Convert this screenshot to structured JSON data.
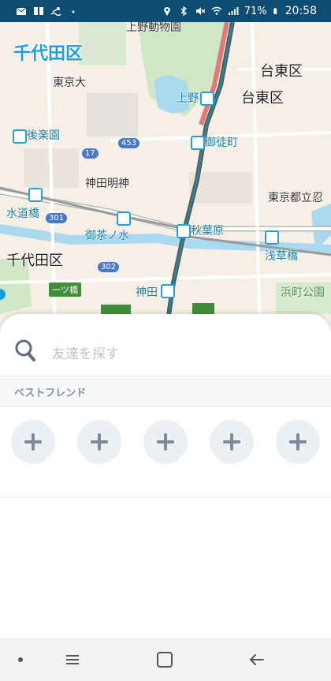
{
  "status_bar": {
    "battery": "71%",
    "time": "20:58",
    "icons": [
      "mail-icon",
      "book-icon",
      "swim-icon",
      "dot-icon",
      "location-icon",
      "bluetooth-icon",
      "mute-icon",
      "wifi-icon",
      "signal-icon",
      "battery-icon"
    ]
  },
  "map": {
    "ward_title": "千代田区",
    "labels": {
      "ueno_zoo": "上野動物園",
      "taito_ku_1": "台東区",
      "taito_ku_2": "台東区",
      "todai": "東京大",
      "ueno": "上野",
      "korakuen": "後楽園",
      "okachimachi": "御徒町",
      "kanda_myojin": "神田明神",
      "tokyo_toritsu": "東京都立忍",
      "suidobashi": "水道橋",
      "akihabara": "秋葉原",
      "ochanomizu": "御茶ノ水",
      "asakusabashi": "浅草橋",
      "chiyoda_ku": "千代田区",
      "hitotsubashi": "一ツ橋",
      "kanda": "神田",
      "hamacho_park": "浜町公園"
    },
    "route_badges": {
      "r17": "17",
      "r453": "453",
      "r301": "301",
      "r302": "302"
    }
  },
  "sheet": {
    "search_placeholder": "友達を探す",
    "section_title": "ベストフレンド",
    "best_friend_slots": [
      "add-friend-1",
      "add-friend-2",
      "add-friend-3",
      "add-friend-4",
      "add-friend-5"
    ]
  },
  "nav_bar": {
    "buttons": [
      "dot-icon",
      "recent-apps-icon",
      "home-icon",
      "back-icon"
    ]
  },
  "colors": {
    "status_bar": "#0e4d73",
    "title_accent": "#1aa0d8",
    "station_text": "#1d7fa3",
    "slot_bg": "#edf0f3",
    "plus": "#7d8a99"
  }
}
